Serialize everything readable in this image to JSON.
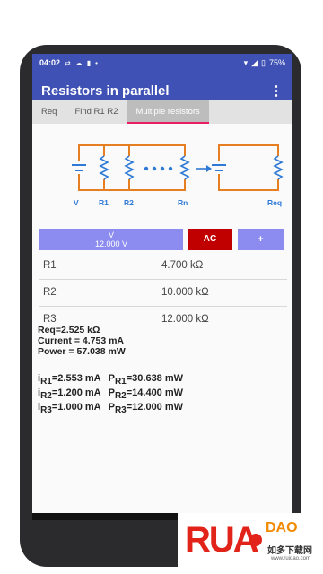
{
  "status": {
    "time": "04:02",
    "battery": "75%"
  },
  "appbar": {
    "title": "Resistors in parallel"
  },
  "tabs": [
    {
      "label": "Req"
    },
    {
      "label": "Find R1 R2"
    },
    {
      "label": "Multiple resistors"
    }
  ],
  "diagram": {
    "labels": {
      "v": "V",
      "r1": "R1",
      "r2": "R2",
      "rn": "Rn",
      "req": "Req"
    },
    "colors": {
      "wire": "#e67e22",
      "component": "#2e7ad6",
      "arrow": "#2e7ad6",
      "label": "#2e7ad6"
    }
  },
  "buttons": {
    "v_label": "V",
    "v_value": "12.000 V",
    "ac": "AC",
    "plus": "+"
  },
  "resistors": [
    {
      "name": "R1",
      "value": "4.700 kΩ"
    },
    {
      "name": "R2",
      "value": "10.000 kΩ"
    },
    {
      "name": "R3",
      "value": "12.000 kΩ"
    }
  ],
  "results": {
    "req": "Req=2.525 kΩ",
    "current": "Current = 4.753 mA",
    "power": "Power = 57.038 mW"
  },
  "per_resistor": [
    {
      "i_sub": "R1",
      "i_val": "=2.553 mA",
      "p_sub": "R1",
      "p_val": "=30.638 mW"
    },
    {
      "i_sub": "R2",
      "i_val": "=1.200 mA",
      "p_sub": "R2",
      "p_val": "=14.400 mW"
    },
    {
      "i_sub": "R3",
      "i_val": "=1.000 mA",
      "p_sub": "R3",
      "p_val": "=12.000 mW"
    }
  ],
  "watermark": {
    "logo": "RUANDAO",
    "site_cn": "如多下载网",
    "url": "www.ruidao.com"
  },
  "colors": {
    "primary": "#3f51b5",
    "button": "#8c8cf0",
    "ac": "#c00000",
    "tab_indicator": "#e91e63"
  }
}
